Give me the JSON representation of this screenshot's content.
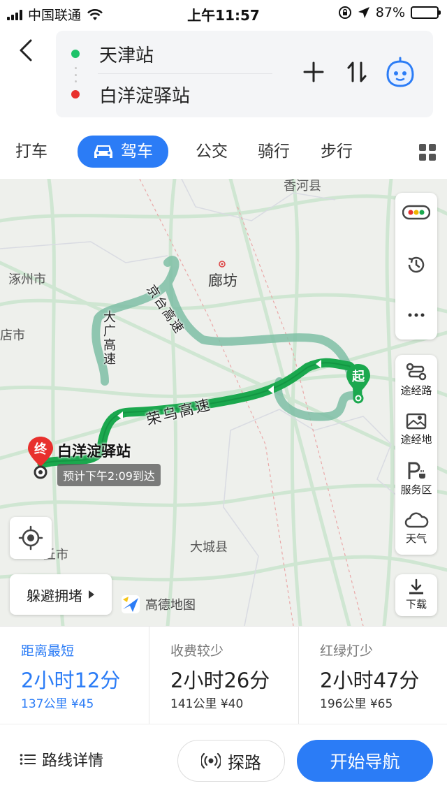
{
  "status_bar": {
    "carrier": "中国联通",
    "time": "上午11:57",
    "battery": "87%",
    "battery_level": 0.87
  },
  "route": {
    "start": "天津站",
    "end": "白洋淀驿站",
    "start_color": "#1ec36a",
    "end_color": "#e8302d"
  },
  "tabs": [
    {
      "label": "打车"
    },
    {
      "label": "驾车",
      "active": true
    },
    {
      "label": "公交"
    },
    {
      "label": "骑行"
    },
    {
      "label": "步行"
    }
  ],
  "map": {
    "labels": {
      "xianghe": "香河县",
      "langfang": "廊坊",
      "zhuozhou": "涿州市",
      "dianshi": "店市",
      "dacheng": "大城县",
      "qiushi": "丘市"
    },
    "roads": {
      "jingtai": "京台高速",
      "dagaung": "大广高速",
      "rongwu": "荣乌高速"
    },
    "start_marker": "起",
    "end_marker": "终",
    "end_name": "白洋淀驿站",
    "eta": "预计下午2:09到达",
    "route_color": "#1ba84e"
  },
  "controls": {
    "waypoint": "途经路",
    "waypoint_place": "途经地",
    "service_area": "服务区",
    "weather": "天气",
    "download": "下载",
    "avoid_jam": "躲避拥堵",
    "logo": "高德地图"
  },
  "options": [
    {
      "title": "距离最短",
      "duration": "2小时12分",
      "meta": "137公里 ¥45",
      "selected": true
    },
    {
      "title": "收费较少",
      "duration": "2小时26分",
      "meta": "141公里 ¥40"
    },
    {
      "title": "红绿灯少",
      "duration": "2小时47分",
      "meta": "196公里 ¥65"
    }
  ],
  "actions": {
    "details": "路线详情",
    "probe": "探路",
    "navigate": "开始导航"
  },
  "accent": "#2b7cf6"
}
